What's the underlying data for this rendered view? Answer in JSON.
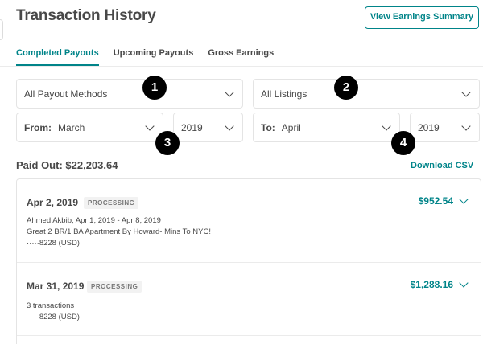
{
  "header": {
    "title": "Transaction History",
    "summary_button": "View Earnings Summary"
  },
  "tabs": [
    {
      "label": "Completed Payouts",
      "active": true
    },
    {
      "label": "Upcoming Payouts",
      "active": false
    },
    {
      "label": "Gross Earnings",
      "active": false
    }
  ],
  "filters": {
    "payout_method": "All Payout Methods",
    "listings": "All Listings",
    "from_label": "From:",
    "from_month": "March",
    "from_year": "2019",
    "to_label": "To:",
    "to_month": "April",
    "to_year": "2019"
  },
  "markers": [
    "1",
    "2",
    "3",
    "4"
  ],
  "summary": {
    "paid_out": "Paid Out: $22,203.64",
    "download": "Download CSV"
  },
  "transactions": [
    {
      "date": "Apr 2, 2019",
      "status": "PROCESSING",
      "amount": "$952.54",
      "lines": [
        "Ahmed Akbib, Apr 1, 2019 - Apr 8, 2019",
        "Great 2 BR/1 BA Apartment By Howard- Mins To NYC!",
        "·····8228 (USD)"
      ]
    },
    {
      "date": "Mar 31, 2019",
      "status": "PROCESSING",
      "amount": "$1,288.16",
      "lines": [
        "3 transactions",
        "·····8228 (USD)"
      ]
    }
  ],
  "colors": {
    "accent": "#008489",
    "text": "#484848",
    "border": "#e4e4e4"
  }
}
